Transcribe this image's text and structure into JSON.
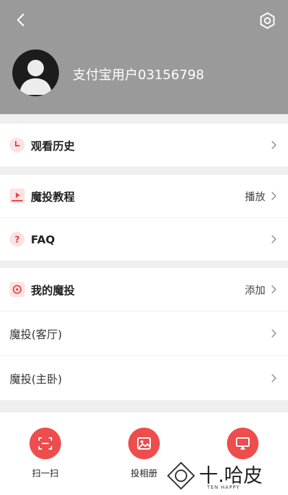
{
  "header": {
    "username": "支付宝用户03156798",
    "back_icon": "chevron-left-icon",
    "settings_icon": "gear-icon"
  },
  "menu": {
    "history": {
      "label": "观看历史",
      "icon": "clock-icon"
    },
    "tutorial": {
      "label": "魔投教程",
      "action": "播放",
      "icon": "play-video-icon"
    },
    "faq": {
      "label": "FAQ",
      "icon": "question-icon"
    },
    "my_cast": {
      "label": "我的魔投",
      "action": "添加",
      "icon": "cast-device-icon"
    },
    "devices": [
      {
        "label": "魔投(客厅)"
      },
      {
        "label": "魔投(主卧)"
      }
    ]
  },
  "actions": [
    {
      "label": "扫一扫",
      "icon": "scan-icon"
    },
    {
      "label": "投相册",
      "icon": "image-icon"
    },
    {
      "label": "",
      "icon": "screen-mirror-icon"
    }
  ],
  "watermark": {
    "brand": "十.哈皮",
    "sub": "TEN HAPPY"
  },
  "colors": {
    "accent": "#ee4d4d",
    "header_bg": "#9a9a9a",
    "icon_bg": "#fde3e3"
  }
}
